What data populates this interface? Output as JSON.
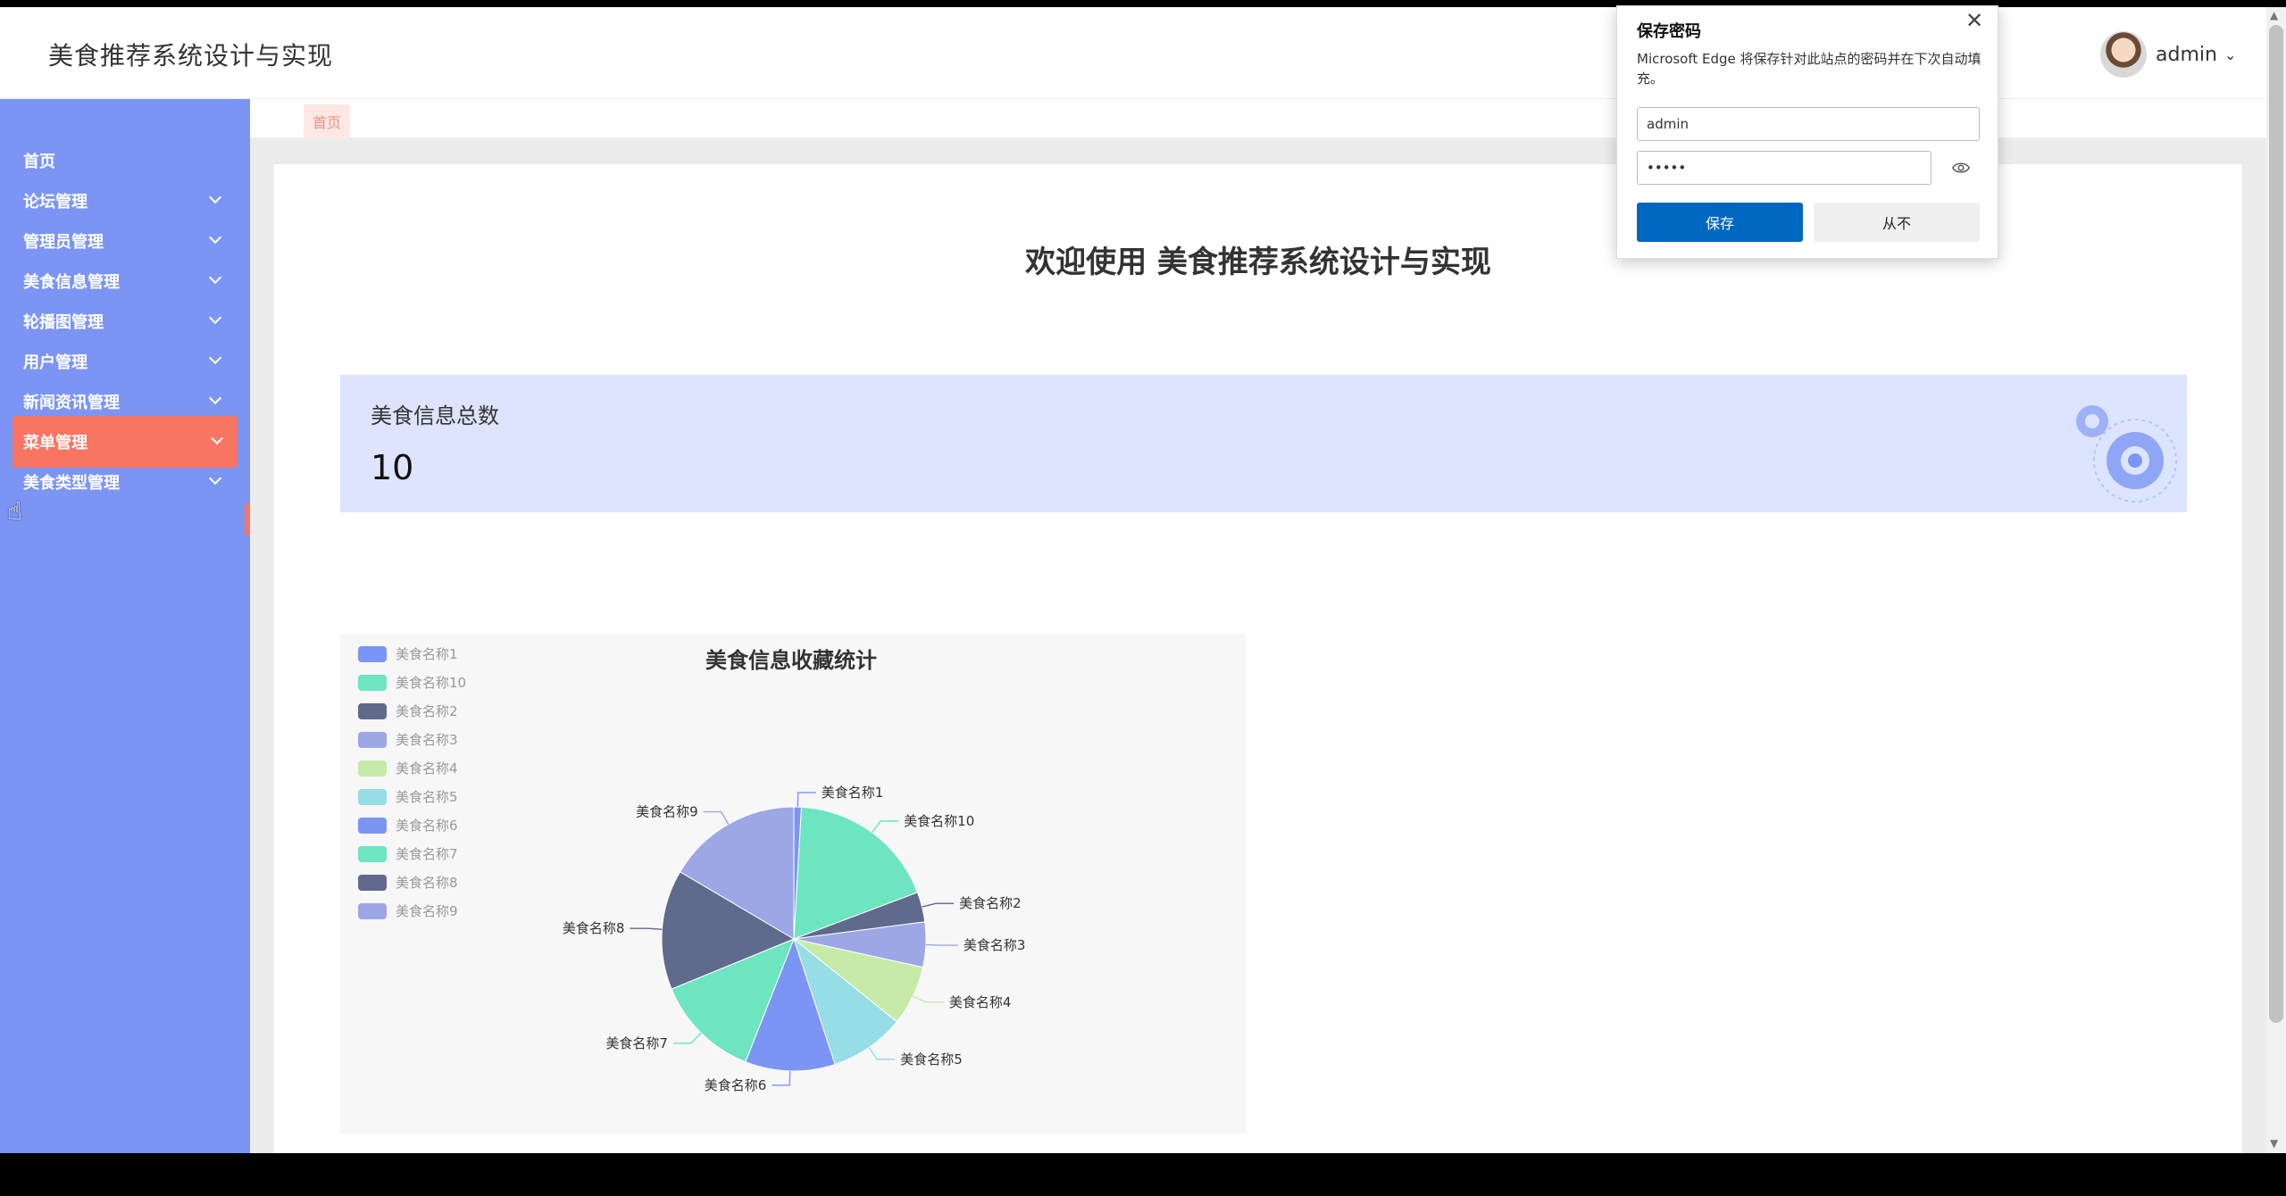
{
  "app": {
    "title": "美食推荐系统设计与实现"
  },
  "user": {
    "name": "admin"
  },
  "sidebar": {
    "items": [
      {
        "label": "首页",
        "expandable": false,
        "active": false
      },
      {
        "label": "论坛管理",
        "expandable": true,
        "active": false
      },
      {
        "label": "管理员管理",
        "expandable": true,
        "active": false
      },
      {
        "label": "美食信息管理",
        "expandable": true,
        "active": false
      },
      {
        "label": "轮播图管理",
        "expandable": true,
        "active": false
      },
      {
        "label": "用户管理",
        "expandable": true,
        "active": false
      },
      {
        "label": "新闻资讯管理",
        "expandable": true,
        "active": false
      },
      {
        "label": "菜单管理",
        "expandable": true,
        "active": true
      },
      {
        "label": "美食类型管理",
        "expandable": true,
        "active": false
      }
    ]
  },
  "tabs": {
    "home": "首页"
  },
  "main": {
    "welcome": "欢迎使用 美食推荐系统设计与实现",
    "stat": {
      "label": "美食信息总数",
      "value": "10"
    }
  },
  "password_popup": {
    "title": "保存密码",
    "description": "Microsoft Edge 将保存针对此站点的密码并在下次自动填充。",
    "username": "admin",
    "password_masked": "•••••",
    "save_label": "保存",
    "never_label": "从不"
  },
  "colors": {
    "sidebar": "#7c95f4",
    "active": "#f87563",
    "stat_bg": "#dde4fd",
    "edge_blue": "#0067c0"
  },
  "chart_data": {
    "type": "pie",
    "title": "美食信息收藏统计",
    "legend_position": "top-left",
    "series": [
      {
        "name": "美食名称1",
        "value": 1,
        "color": "#7c95f4"
      },
      {
        "name": "美食名称10",
        "value": 20,
        "color": "#6ce5c0"
      },
      {
        "name": "美食名称2",
        "value": 4,
        "color": "#606a8c"
      },
      {
        "name": "美食名称3",
        "value": 6,
        "color": "#9da7e6"
      },
      {
        "name": "美食名称4",
        "value": 8,
        "color": "#c6eba8"
      },
      {
        "name": "美食名称5",
        "value": 10,
        "color": "#96dde6"
      },
      {
        "name": "美食名称6",
        "value": 12,
        "color": "#7c95f4"
      },
      {
        "name": "美食名称7",
        "value": 14,
        "color": "#6ce5c0"
      },
      {
        "name": "美食名称8",
        "value": 16,
        "color": "#606a8c"
      },
      {
        "name": "美食名称9",
        "value": 18,
        "color": "#9da7e6"
      }
    ]
  }
}
